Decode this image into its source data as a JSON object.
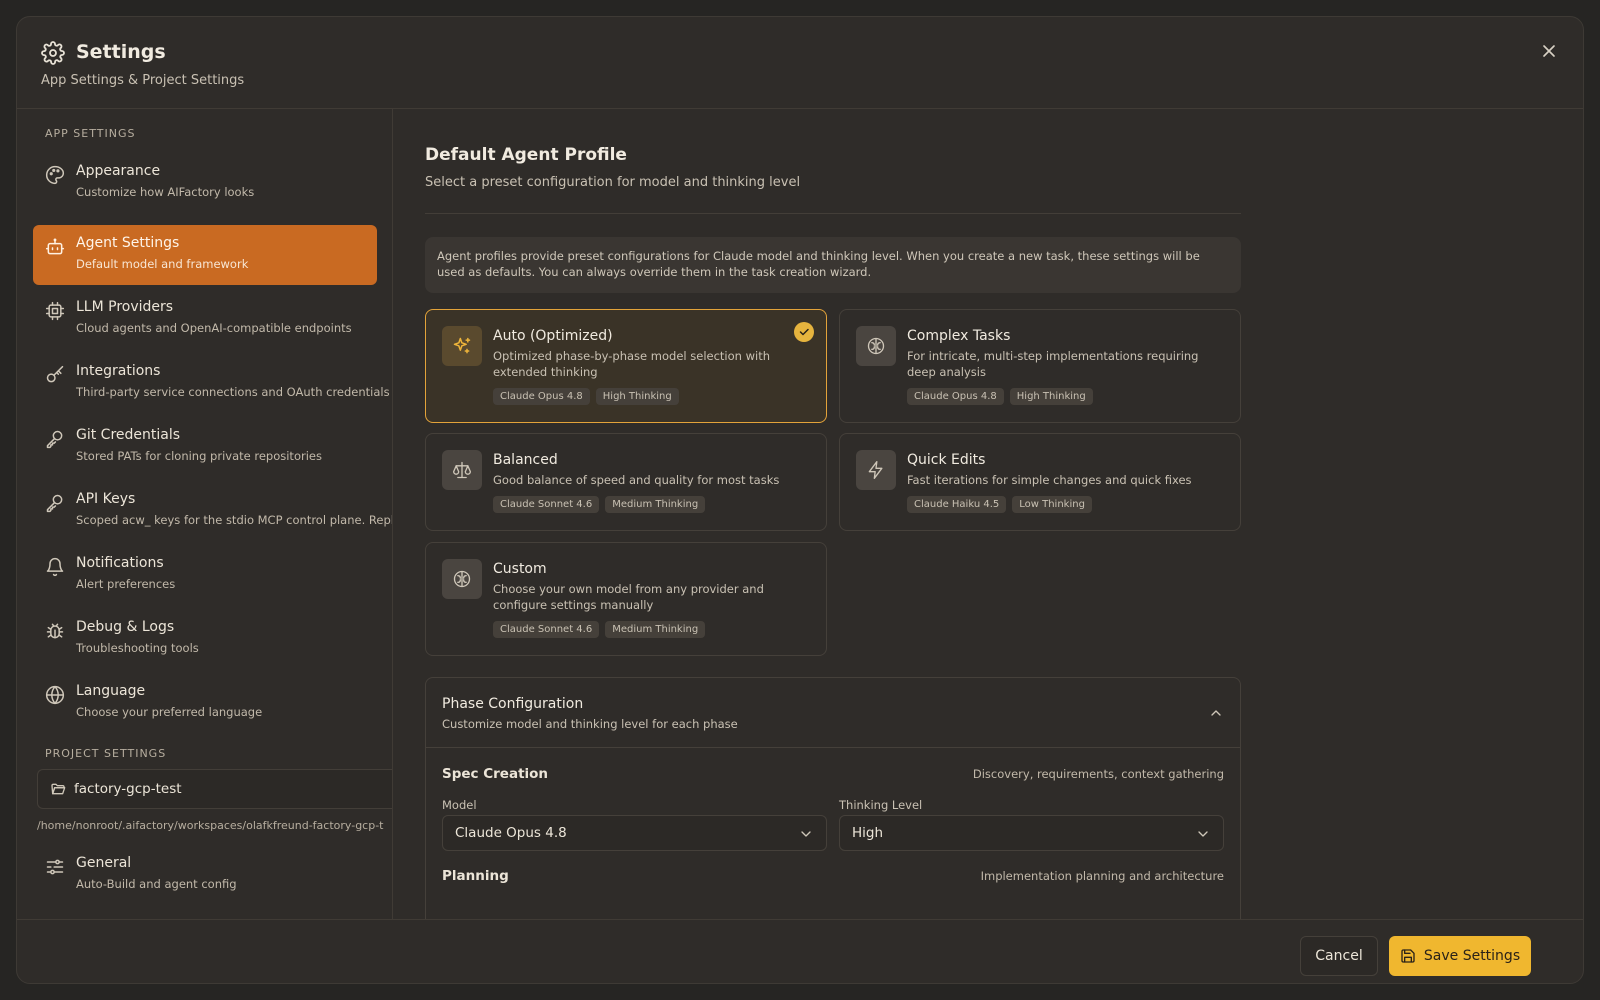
{
  "header": {
    "title": "Settings",
    "subtitle": "App Settings & Project Settings"
  },
  "sidebar": {
    "app_section_label": "APP SETTINGS",
    "items": [
      {
        "label": "Appearance",
        "desc": "Customize how AIFactory looks",
        "icon": "palette-icon"
      },
      {
        "label": "Agent Settings",
        "desc": "Default model and framework",
        "icon": "bot-icon",
        "active": true
      },
      {
        "label": "LLM Providers",
        "desc": "Cloud agents and OpenAI-compatible endpoints",
        "icon": "cpu-icon"
      },
      {
        "label": "Integrations",
        "desc": "Third-party service connections and OAuth credentials",
        "icon": "key-icon"
      },
      {
        "label": "Git Credentials",
        "desc": "Stored PATs for cloning private repositories",
        "icon": "key-icon"
      },
      {
        "label": "API Keys",
        "desc": "Scoped acw_ keys for the stdio MCP control plane. Replac",
        "icon": "key-icon"
      },
      {
        "label": "Notifications",
        "desc": "Alert preferences",
        "icon": "bell-icon"
      },
      {
        "label": "Debug & Logs",
        "desc": "Troubleshooting tools",
        "icon": "bug-icon"
      },
      {
        "label": "Language",
        "desc": "Choose your preferred language",
        "icon": "globe-icon"
      }
    ],
    "project_section_label": "PROJECT SETTINGS",
    "project_name": "factory-gcp-test",
    "project_path": "/home/nonroot/.aifactory/workspaces/olafkfreund-factory-gcp-t",
    "project_items": [
      {
        "label": "General",
        "desc": "Auto-Build and agent config",
        "icon": "sliders-icon"
      }
    ]
  },
  "main": {
    "title": "Default Agent Profile",
    "subtitle": "Select a preset configuration for model and thinking level",
    "info": "Agent profiles provide preset configurations for Claude model and thinking level. When you create a new task, these settings will be used as defaults. You can always override them in the task creation wizard.",
    "profiles": [
      {
        "title": "Auto (Optimized)",
        "desc": "Optimized phase-by-phase model selection with extended thinking",
        "model": "Claude Opus 4.8",
        "thinking": "High Thinking",
        "selected": true,
        "icon": "sparkles-icon"
      },
      {
        "title": "Complex Tasks",
        "desc": "For intricate, multi-step implementations requiring deep analysis",
        "model": "Claude Opus 4.8",
        "thinking": "High Thinking",
        "icon": "brain-icon"
      },
      {
        "title": "Balanced",
        "desc": "Good balance of speed and quality for most tasks",
        "model": "Claude Sonnet 4.6",
        "thinking": "Medium Thinking",
        "icon": "scale-icon"
      },
      {
        "title": "Quick Edits",
        "desc": "Fast iterations for simple changes and quick fixes",
        "model": "Claude Haiku 4.5",
        "thinking": "Low Thinking",
        "icon": "zap-icon"
      },
      {
        "title": "Custom",
        "desc": "Choose your own model from any provider and configure settings manually",
        "model": "Claude Sonnet 4.6",
        "thinking": "Medium Thinking",
        "icon": "brain-icon"
      }
    ],
    "phase": {
      "title": "Phase Configuration",
      "subtitle": "Customize model and thinking level for each phase",
      "rows": [
        {
          "name": "Spec Creation",
          "desc": "Discovery, requirements, context gathering",
          "model_label": "Model",
          "model": "Claude Opus 4.8",
          "thinking_label": "Thinking Level",
          "thinking": "High"
        },
        {
          "name": "Planning",
          "desc": "Implementation planning and architecture"
        }
      ]
    }
  },
  "footer": {
    "cancel": "Cancel",
    "save": "Save Settings"
  },
  "colors": {
    "accent": "#c96a22",
    "save_button": "#f0b72f",
    "selected_border": "#e3a33a",
    "background": "#2f2c29"
  }
}
